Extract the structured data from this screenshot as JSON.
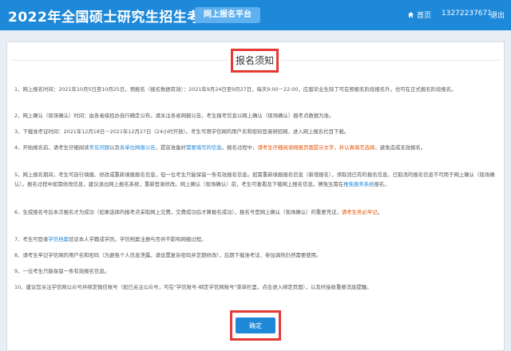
{
  "header": {
    "site_title": "2022年全国硕士研究生招生考试",
    "platform": "网上报名平台",
    "home_label": "首页",
    "phone": "13272237671",
    "logout": "退出",
    "bg_color": "#1e88d9"
  },
  "notice": {
    "title": "报名须知",
    "items": {
      "i1": "1、网上报名时间：2021年10月5日至10月25日，预报名（报名数据有效）：2021年9月24日至9月27日，每天9:00－22:00，应届毕业生除了可在预报名阶段报名外，也可在正式报名阶段报名。",
      "i2": "2、网上确认（现场确认）时间：由各省级招办自行确定公布，请关注各省网报公告，考生报考信息以网上确认（现场确认）报考点数据为准。",
      "i3": "3、下载准考证时间：2021年12月18日－2021年12月27日（24小时开放）。考生可用学信网的用户名和密码登录研招网，进入网上报名栏目下载。",
      "i4a": "4、开始报名前，请考生仔细阅读",
      "i4b": "常见问题",
      "i4c": "以及",
      "i4d": "各单位网报公告",
      "i4e": "，提前准备好",
      "i4f": "需要填写的信息",
      "i4g": "。报名过程中，",
      "i4h": "请考生仔细阅读网报页面提示文字，并认真填写选择",
      "i4i": "，避免造成无效报名。",
      "i5a": "5、网上报名期间，考生可自行填报、修改或重新填报报名信息，但一位考生只能保留一条有效报名信息。如需重新填报报名信息（新增报名），须取消已有的报名信息，已取消的报名信息不可用于网上确认（现场确认）。报名过程中如需修改信息，建议退出网上报名系统，重新登录修改。网上确认（现场确认）前，考生可查看及下载网上报名信息。擦免生需在",
      "i5b": "推免服务系统",
      "i5c": "报名。",
      "i6a": "6、生成报名号后本次报名才为成功（如果选择的报考点采取网上交费，交费成功后才算报名成功），报名号是网上确认（现场确认）的重要凭证，",
      "i6b": "请考生务必牢记",
      "i6c": "。",
      "i7a": "7、考生可登录",
      "i7b": "学信档案",
      "i7c": "验证本人学籍或学历。学信档案注册与否并不影响网报过程。",
      "i8": "8、请考生牢记学信网的用户名和密码（为避免个人信息泄露，请设置复杂密码并定期修改），后期下载准考证、参加调剂仍然需要使用。",
      "i9": "9、一位考生只能保留一条有效报名信息。",
      "i10": "10、建议您关注学信网公众号并绑定微信账号（如已关注公众号，可在\"学信账号-绑定学信网账号\"菜单栏里，点击进入绑定页面），以及时接收重要消息提醒。"
    }
  },
  "confirm_label": "确定"
}
